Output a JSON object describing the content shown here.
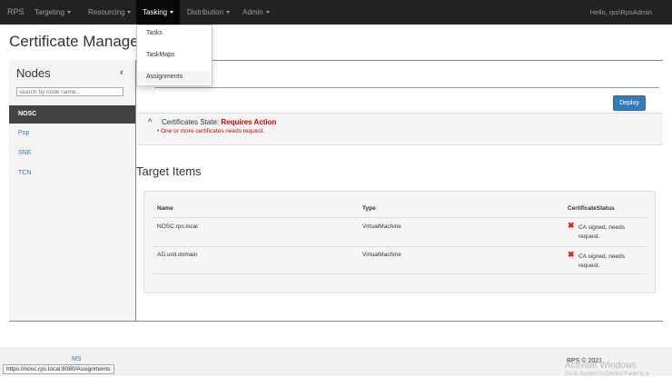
{
  "navbar": {
    "brand": "RPS",
    "items": [
      {
        "label": "Targeting"
      },
      {
        "label": "Resourcing"
      },
      {
        "label": "Tasking"
      },
      {
        "label": "Distribution"
      },
      {
        "label": "Admin"
      }
    ],
    "user_greeting": "Hello, rps\\RpsAdmin"
  },
  "dropdown": {
    "items": [
      {
        "label": "Tasks"
      },
      {
        "label": "TaskMaps"
      },
      {
        "label": "Assignments"
      }
    ]
  },
  "page": {
    "title": "Certificate Managen"
  },
  "sidebar": {
    "heading": "Nodes",
    "collapse_glyph": "‹",
    "search_placeholder": "search by node name...",
    "nodes": [
      {
        "label": "NOSC",
        "active": true
      },
      {
        "label": "Pop"
      },
      {
        "label": "SNE"
      },
      {
        "label": "TCN"
      }
    ]
  },
  "main": {
    "deploy_label": "Deploy",
    "state": {
      "chevron": "^",
      "label": "Certificates State:",
      "value": "Requires Action",
      "bullet": "One or more certificates needs request."
    },
    "target_heading": "Target Items",
    "table": {
      "headers": [
        "Name",
        "Type",
        "CertificateStatus"
      ],
      "rows": [
        {
          "name": "NOSC.rps.local",
          "type": "VirtualMachine",
          "status": "CA signed, needs request."
        },
        {
          "name": "AD.unit.domain",
          "type": "VirtualMachine",
          "status": "CA signed, needs request."
        }
      ],
      "status_icon": "✖"
    }
  },
  "footer": {
    "ms_link": "MS",
    "copyright": "RPS © 2021",
    "watermark_title": "Activate Windows",
    "watermark_sub": "Go to System in Control Panel to a"
  },
  "status_bar": {
    "url": "https://nosc.rps.local:8080/Assignments"
  },
  "colors": {
    "navbar": "#222222",
    "accent": "#337ab7",
    "alert": "#cc0000"
  }
}
